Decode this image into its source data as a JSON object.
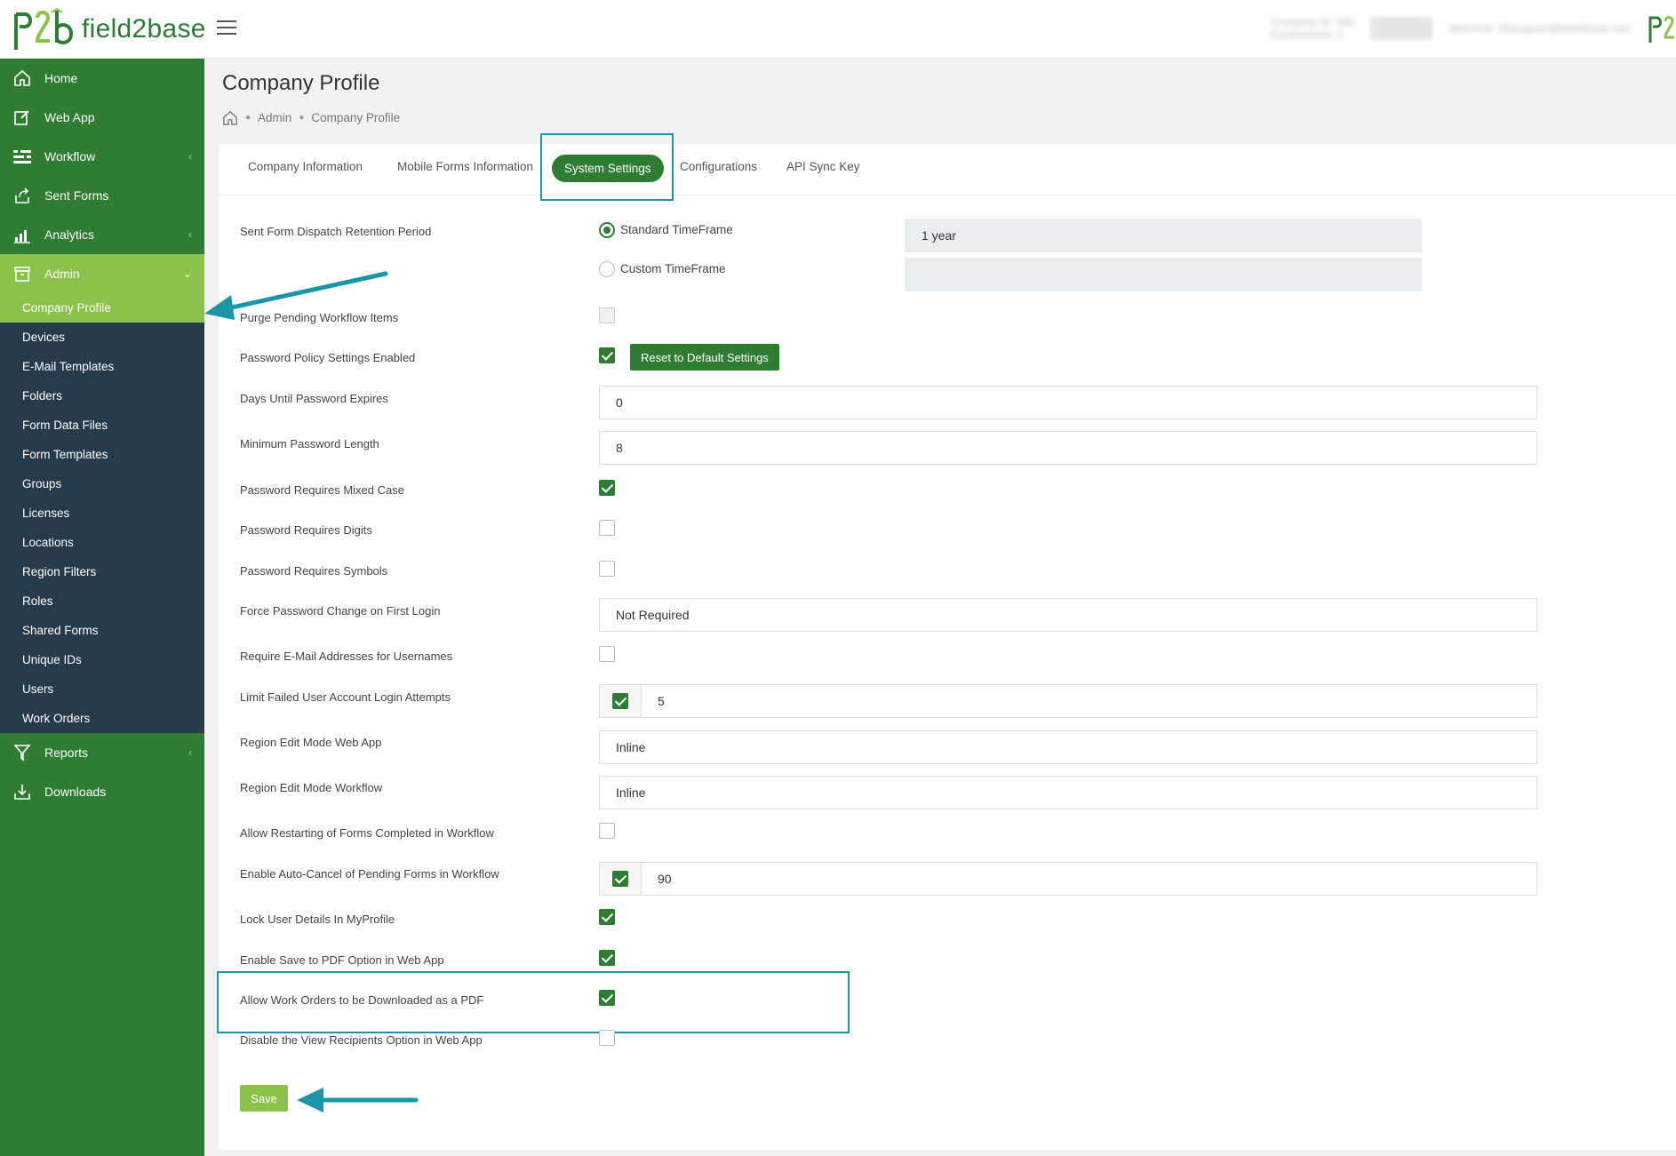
{
  "app": {
    "name": "field2base"
  },
  "header": {
    "company_line1": "Company ID: 000",
    "company_line2": "Environment: 2",
    "user_pill": "Log Out",
    "welcome": "Welcome: f2bsupport@field2base.com"
  },
  "sidebar": {
    "items": [
      {
        "label": "Home",
        "icon": "home-icon"
      },
      {
        "label": "Web App",
        "icon": "edit-icon"
      },
      {
        "label": "Workflow",
        "icon": "workflow-icon"
      },
      {
        "label": "Sent Forms",
        "icon": "share-icon"
      },
      {
        "label": "Analytics",
        "icon": "chart-icon"
      },
      {
        "label": "Admin",
        "icon": "archive-icon"
      }
    ],
    "admin_items": [
      "Company Profile",
      "Devices",
      "E-Mail Templates",
      "Folders",
      "Form Data Files",
      "Form Templates",
      "Groups",
      "Licenses",
      "Locations",
      "Region Filters",
      "Roles",
      "Shared Forms",
      "Unique IDs",
      "Users",
      "Work Orders"
    ],
    "bottom_items": [
      {
        "label": "Reports",
        "icon": "filter-icon"
      },
      {
        "label": "Downloads",
        "icon": "download-icon"
      }
    ]
  },
  "page": {
    "title": "Company Profile",
    "breadcrumb": [
      "Admin",
      "Company Profile"
    ]
  },
  "tabs": [
    "Company Information",
    "Mobile Forms Information",
    "System Settings",
    "Configurations",
    "API Sync Key"
  ],
  "settings": {
    "retention_label": "Sent Form Dispatch Retention Period",
    "standard_timeframe": "Standard TimeFrame",
    "custom_timeframe": "Custom TimeFrame",
    "standard_value": "1 year",
    "custom_value": "",
    "purge": "Purge Pending Workflow Items",
    "password_policy": "Password Policy Settings Enabled",
    "reset_button": "Reset to Default Settings",
    "days_expire": "Days Until Password Expires",
    "days_expire_value": "0",
    "min_length": "Minimum Password Length",
    "min_length_value": "8",
    "mixed_case": "Password Requires Mixed Case",
    "digits": "Password Requires Digits",
    "symbols": "Password Requires Symbols",
    "force_change": "Force Password Change on First Login",
    "force_change_value": "Not Required",
    "require_email": "Require E-Mail Addresses for Usernames",
    "limit_failed": "Limit Failed User Account Login Attempts",
    "limit_failed_value": "5",
    "region_webapp": "Region Edit Mode Web App",
    "region_webapp_value": "Inline",
    "region_workflow": "Region Edit Mode Workflow",
    "region_workflow_value": "Inline",
    "allow_restart": "Allow Restarting of Forms Completed in Workflow",
    "auto_cancel": "Enable Auto-Cancel of Pending Forms in Workflow",
    "auto_cancel_value": "90",
    "lock_user": "Lock User Details In MyProfile",
    "save_pdf": "Enable Save to PDF Option in Web App",
    "work_orders_pdf": "Allow Work Orders to be Downloaded as a PDF",
    "disable_recipients": "Disable the View Recipients Option in Web App",
    "save_button": "Save"
  },
  "colors": {
    "brand_green": "#2e7d32",
    "accent_lime": "#8bc34a",
    "highlight_teal": "#1b96a6",
    "sidebar_sub_bg": "#253a4a"
  }
}
